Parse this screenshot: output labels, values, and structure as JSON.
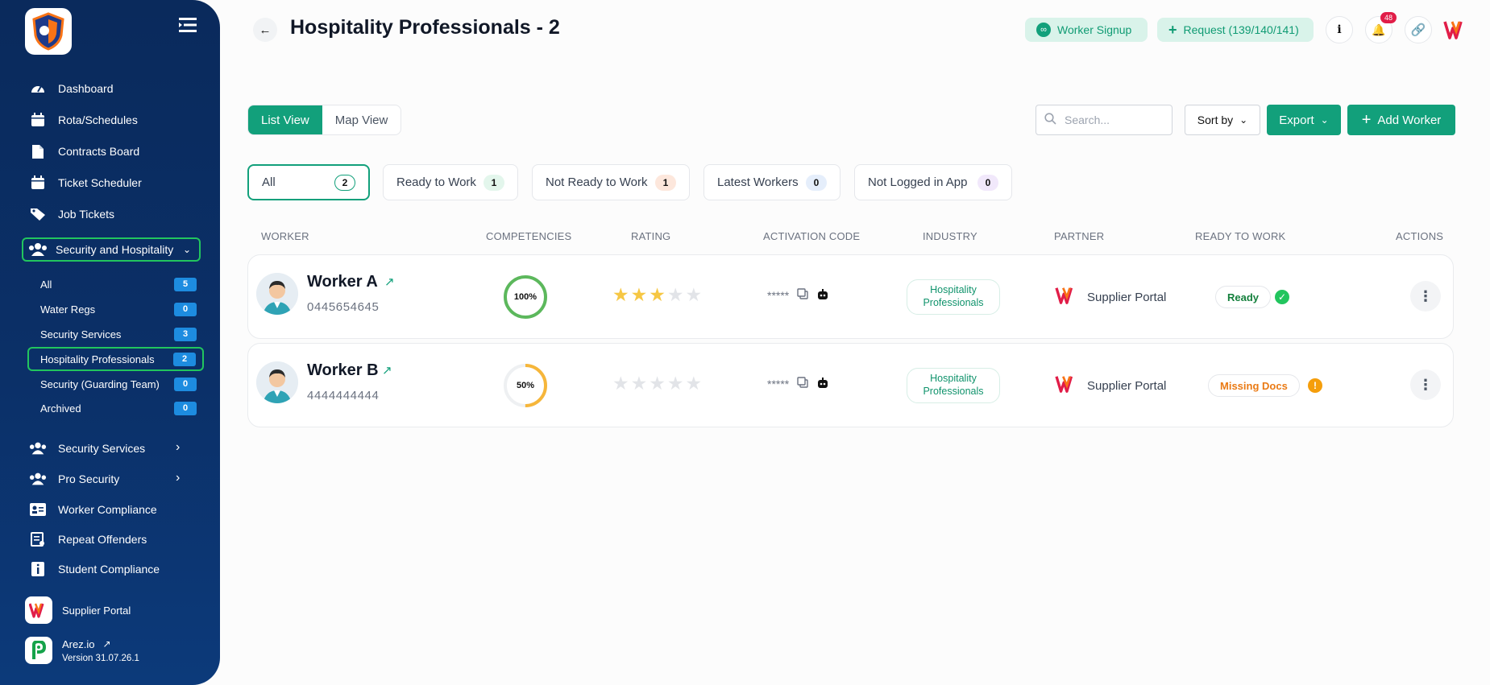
{
  "sidebar": {
    "nav": [
      {
        "label": "Dashboard",
        "icon": "dashboard-icon"
      },
      {
        "label": "Rota/Schedules",
        "icon": "calendar-icon"
      },
      {
        "label": "Contracts Board",
        "icon": "document-icon"
      },
      {
        "label": "Ticket Scheduler",
        "icon": "calendar-icon"
      },
      {
        "label": "Job Tickets",
        "icon": "tag-icon"
      }
    ],
    "group": {
      "label": "Security and Hospitality",
      "icon": "users-icon"
    },
    "sub_items": [
      {
        "label": "All",
        "count": "5"
      },
      {
        "label": "Water Regs",
        "count": "0"
      },
      {
        "label": "Security Services",
        "count": "3"
      },
      {
        "label": "Hospitality Professionals",
        "count": "2"
      },
      {
        "label": "Security (Guarding Team)",
        "count": "0"
      },
      {
        "label": "Archived",
        "count": "0"
      }
    ],
    "nav2": [
      {
        "label": "Security Services",
        "icon": "users-icon"
      },
      {
        "label": "Pro Security",
        "icon": "users-icon"
      },
      {
        "label": "Worker Compliance",
        "icon": "id-card-icon"
      },
      {
        "label": "Repeat Offenders",
        "icon": "report-icon"
      },
      {
        "label": "Student Compliance",
        "icon": "info-icon"
      }
    ],
    "supplier_portal": "Supplier Portal",
    "app_name": "Arez.io",
    "version": "Version 31.07.26.1"
  },
  "header": {
    "title": "Hospitality Professionals - 2",
    "worker_signup": "Worker Signup",
    "request": "Request (139/140/141)",
    "notification_count": "48"
  },
  "toolbar": {
    "list_view": "List View",
    "map_view": "Map View",
    "search_placeholder": "Search...",
    "sort_by": "Sort by",
    "export": "Export",
    "add_worker": "Add Worker"
  },
  "filters": [
    {
      "label": "All",
      "count": "2"
    },
    {
      "label": "Ready to Work",
      "count": "1"
    },
    {
      "label": "Not Ready to Work",
      "count": "1"
    },
    {
      "label": "Latest Workers",
      "count": "0"
    },
    {
      "label": "Not Logged in App",
      "count": "0"
    }
  ],
  "table": {
    "columns": [
      "WORKER",
      "COMPETENCIES",
      "RATING",
      "ACTIVATION CODE",
      "INDUSTRY",
      "PARTNER",
      "READY TO WORK",
      "ACTIONS"
    ],
    "rows": [
      {
        "name": "Worker A",
        "phone": "0445654645",
        "competency": "100%",
        "competency_value": 100,
        "rating": 3,
        "code": "*****",
        "industry": "Hospitality Professionals",
        "partner": "Supplier Portal",
        "status": "Ready"
      },
      {
        "name": "Worker B",
        "phone": "4444444444",
        "competency": "50%",
        "competency_value": 50,
        "rating": 0,
        "code": "*****",
        "industry": "Hospitality Professionals",
        "partner": "Supplier Portal",
        "status": "Missing Docs"
      }
    ]
  },
  "colors": {
    "accent": "#12a07b",
    "sidebar": "#0b3068",
    "ready": "#22c55e",
    "warning": "#f59e0b",
    "star": "#f6c744"
  }
}
